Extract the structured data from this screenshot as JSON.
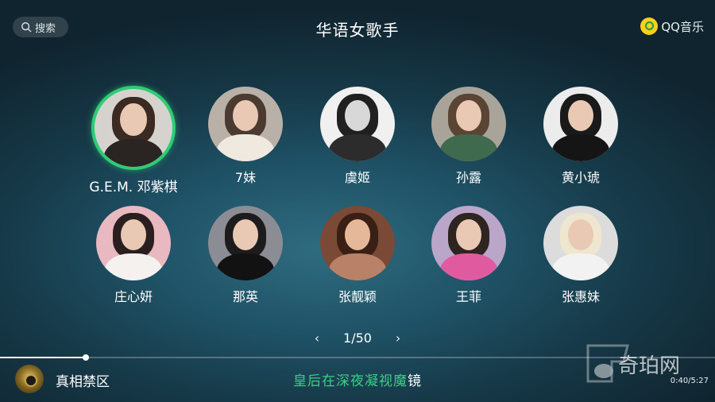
{
  "header": {
    "search_label": "搜索",
    "title": "华语女歌手",
    "brand": "QQ音乐"
  },
  "singers": [
    {
      "name": "G.E.M. 邓紫棋",
      "selected": true
    },
    {
      "name": "7妹"
    },
    {
      "name": "虞姬"
    },
    {
      "name": "孙露"
    },
    {
      "name": "黄小琥"
    },
    {
      "name": "庄心妍"
    },
    {
      "name": "那英"
    },
    {
      "name": "张靓颖"
    },
    {
      "name": "王菲"
    },
    {
      "name": "张惠妹"
    }
  ],
  "pager": {
    "label": "1/50",
    "prev_icon": "chevron-left-icon",
    "next_icon": "chevron-right-icon"
  },
  "now_playing": {
    "title": "真相禁区",
    "lyric_highlight": "皇后在深夜凝视魔",
    "lyric_rest": "镜",
    "time": "0:40/5:27",
    "progress": 0.12
  },
  "watermark": {
    "text": "奇珀网"
  },
  "colors": {
    "accent": "#2fcc75",
    "lyric": "#39d184"
  }
}
